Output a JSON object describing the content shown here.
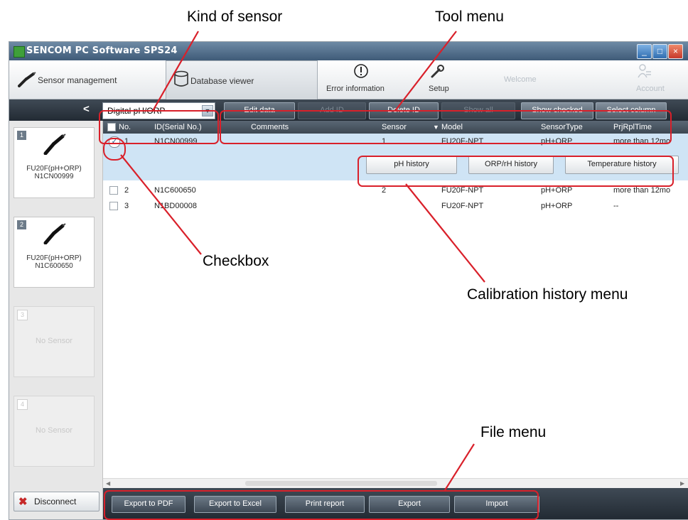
{
  "annotations": {
    "kind_of_sensor": "Kind of sensor",
    "tool_menu": "Tool menu",
    "checkbox": "Checkbox",
    "calibration_history_menu": "Calibration history menu",
    "file_menu": "File menu"
  },
  "window": {
    "title": "SENCOM PC Software SPS24",
    "min": "_",
    "max": "□",
    "close": "×"
  },
  "main_tabs": {
    "sensor_management": "Sensor management",
    "database_viewer": "Database viewer",
    "error_information": "Error information",
    "setup": "Setup",
    "welcome": "Welcome",
    "account": "Account"
  },
  "toolbar": {
    "back": "<",
    "sensor_kind": "Digital pH/ORP",
    "edit_data": "Edit data",
    "add_id": "Add ID",
    "delete_id": "Delete ID",
    "show_all": "Show all",
    "show_checked": "Show checked",
    "select_column": "Select column"
  },
  "grid": {
    "columns": [
      "No.",
      "ID(Serial No.)",
      "Comments",
      "Sensor",
      "Model",
      "SensorType",
      "PrjRplTime"
    ],
    "rows": [
      {
        "no": "1",
        "id": "N1CN00999",
        "comments": "",
        "sensor": "1",
        "model": "FU20F-NPT",
        "type": "pH+ORP",
        "time": "more than 12mo"
      },
      {
        "no": "2",
        "id": "N1C600650",
        "comments": "",
        "sensor": "2",
        "model": "FU20F-NPT",
        "type": "pH+ORP",
        "time": "more than 12mo"
      },
      {
        "no": "3",
        "id": "N1BD00008",
        "comments": "",
        "sensor": "",
        "model": "FU20F-NPT",
        "type": "pH+ORP",
        "time": "--"
      }
    ]
  },
  "calibration": {
    "ph_history": "pH history",
    "orp_history": "ORP/rH history",
    "temperature_history": "Temperature history"
  },
  "sensors": [
    {
      "num": "1",
      "model": "FU20F(pH+ORP)",
      "serial": "N1CN00999"
    },
    {
      "num": "2",
      "model": "FU20F(pH+ORP)",
      "serial": "N1C600650"
    },
    {
      "num": "3",
      "label": "No Sensor"
    },
    {
      "num": "4",
      "label": "No Sensor"
    }
  ],
  "disconnect": "Disconnect",
  "file_menu": {
    "export_pdf": "Export to PDF",
    "export_excel": "Export to Excel",
    "print_report": "Print report",
    "export": "Export",
    "import": "Import"
  }
}
